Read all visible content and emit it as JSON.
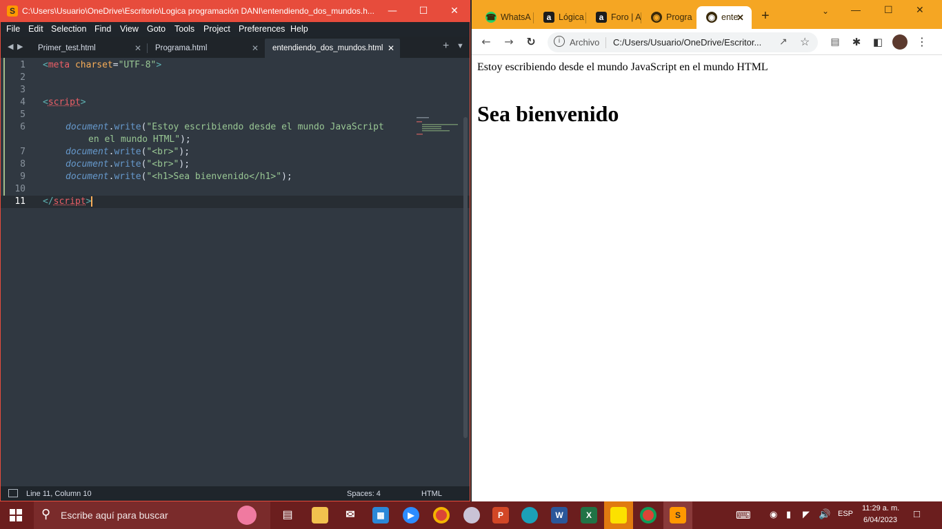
{
  "sublime": {
    "title": "C:\\Users\\Usuario\\OneDrive\\Escritorio\\Logica programación DANI\\entendiendo_dos_mundos.h...",
    "menu": [
      "File",
      "Edit",
      "Selection",
      "Find",
      "View",
      "Goto",
      "Tools",
      "Project",
      "Preferences",
      "Help"
    ],
    "tabs": [
      {
        "label": "Primer_test.html"
      },
      {
        "label": "Programa.html"
      },
      {
        "label": "entendiendo_dos_mundos.html"
      }
    ],
    "line_numbers": [
      "1",
      "2",
      "3",
      "4",
      "5",
      "6",
      "",
      "7",
      "8",
      "9",
      "10",
      "11"
    ],
    "code": {
      "l1_open": "<",
      "l1_tag": "meta",
      "l1_attr": "charset",
      "l1_eq": "=",
      "l1_val": "\"UTF-8\"",
      "l1_close": ">",
      "l4_open": "<",
      "l4_tag": "script",
      "l4_close": ">",
      "obj": "document",
      "dot": ".",
      "fn": "write",
      "paren_open": "(",
      "l6_str_a": "\"Estoy escribiendo desde el mundo JavaScript",
      "l6_str_b": "en el mundo HTML\"",
      "end": ");",
      "l7_str": "\"<br>\"",
      "l8_str": "\"<br>\"",
      "l9_str": "\"<h1>Sea bienvenido</h1>\"",
      "l11_open": "</",
      "l11_tag": "script",
      "l11_close": ">"
    },
    "status": {
      "position": "Line 11, Column 10",
      "spaces": "Spaces: 4",
      "syntax": "HTML"
    }
  },
  "chrome": {
    "tabs": [
      {
        "label": "WhatsA",
        "icon": "whatsapp-icon"
      },
      {
        "label": "Lógica",
        "icon": "alura-icon"
      },
      {
        "label": "Foro | A",
        "icon": "alura-icon"
      },
      {
        "label": "Progra",
        "icon": "globe-icon"
      },
      {
        "label": "ente",
        "icon": "globe-icon"
      }
    ],
    "address": {
      "scheme_label": "Archivo",
      "url": "C:/Users/Usuario/OneDrive/Escritor..."
    },
    "page": {
      "text": "Estoy escribiendo desde el mundo JavaScript en el mundo HTML",
      "heading": "Sea bienvenido"
    }
  },
  "taskbar": {
    "search_placeholder": "Escribe aquí para buscar",
    "language": "ESP",
    "time": "11:29 a. m.",
    "date": "6/04/2023"
  },
  "colors": {
    "sublime_accent": "#e74c3c",
    "chrome_accent": "#f5a623",
    "taskbar": "#6b1e1e"
  }
}
